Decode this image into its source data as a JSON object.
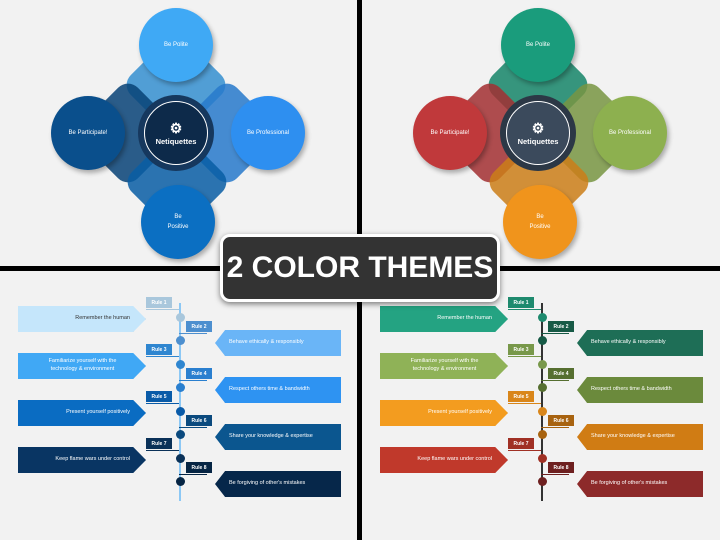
{
  "banner": "2 COLOR THEMES",
  "hub": {
    "center_label": "Netiquettes",
    "center_icon": "gear-magnifier-icon",
    "top": "Be Polite",
    "left": "Be Participate!",
    "right": "Be Professional",
    "bottom_line1": "Be",
    "bottom_line2": "Positive"
  },
  "rules": [
    {
      "tag": "Rule 1",
      "text": "Remember the human"
    },
    {
      "tag": "Rule 2",
      "text": "Behave ethically & responsibly"
    },
    {
      "tag": "Rule 3",
      "text": "Familiarize yourself with the technology & environment"
    },
    {
      "tag": "Rule 4",
      "text": "Respect others time & bandwidth"
    },
    {
      "tag": "Rule 5",
      "text": "Present yourself positively"
    },
    {
      "tag": "Rule 6",
      "text": "Share your knowledge & expertise"
    },
    {
      "tag": "Rule 7",
      "text": "Keep flame wars under control"
    },
    {
      "tag": "Rule 8",
      "text": "Be forgiving of other's mistakes"
    }
  ],
  "themes": {
    "blue": {
      "hub_colors": {
        "top": "#3fa9f5",
        "left": "#0a4f8c",
        "right": "#2e8ff0",
        "bottom": "#0b6fc2",
        "center": "#0d2a4a",
        "ring": "#16385e"
      },
      "axis": "#8cc8f5",
      "rule_colors": [
        "#c5e6fb",
        "#6ab5f7",
        "#40a8f5",
        "#2e93f2",
        "#0a6cc2",
        "#0b568f",
        "#093563",
        "#06274a"
      ],
      "tag_colors": [
        "#a9c7dc",
        "#4d8fcf",
        "#2f86d0",
        "#2a7fcf",
        "#0a5ba8",
        "#0b4a7e",
        "#0a3158",
        "#062544"
      ],
      "rule_text_first": "#333333"
    },
    "multi": {
      "hub_colors": {
        "top": "#1a9c7c",
        "left": "#c0393b",
        "right": "#8db04f",
        "bottom": "#f0941c",
        "center": "#3b4a5c",
        "ring": "#2c3846"
      },
      "axis": "#333333",
      "rule_colors": [
        "#24a382",
        "#1e6e56",
        "#8fb257",
        "#6b8a3c",
        "#f39c1f",
        "#d07c14",
        "#c0392b",
        "#8d2a2a"
      ],
      "tag_colors": [
        "#1e8a6e",
        "#175a46",
        "#78984a",
        "#566f30",
        "#d9861a",
        "#a86310",
        "#a03024",
        "#6e2020"
      ],
      "rule_text_first": "#ffffff"
    }
  }
}
